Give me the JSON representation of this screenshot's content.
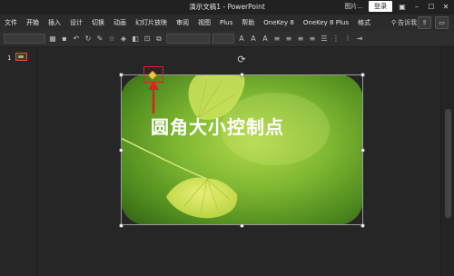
{
  "window": {
    "title": "演示文稿1  -  PowerPoint"
  },
  "titlebar": {
    "truncated_label": "图片...",
    "signin_label": "登录"
  },
  "menu": {
    "items": [
      "文件",
      "开始",
      "插入",
      "设计",
      "切换",
      "动画",
      "幻灯片放映",
      "审阅",
      "视图",
      "Plus",
      "帮助",
      "OneKey 8",
      "OneKey 8 Plus",
      "格式"
    ],
    "search_label": "告诉我"
  },
  "slides": {
    "current_number": "1"
  },
  "slide": {
    "caption": "圆角大小控制点"
  },
  "colors": {
    "annotation": "#e02020",
    "accent": "#e0552b"
  }
}
